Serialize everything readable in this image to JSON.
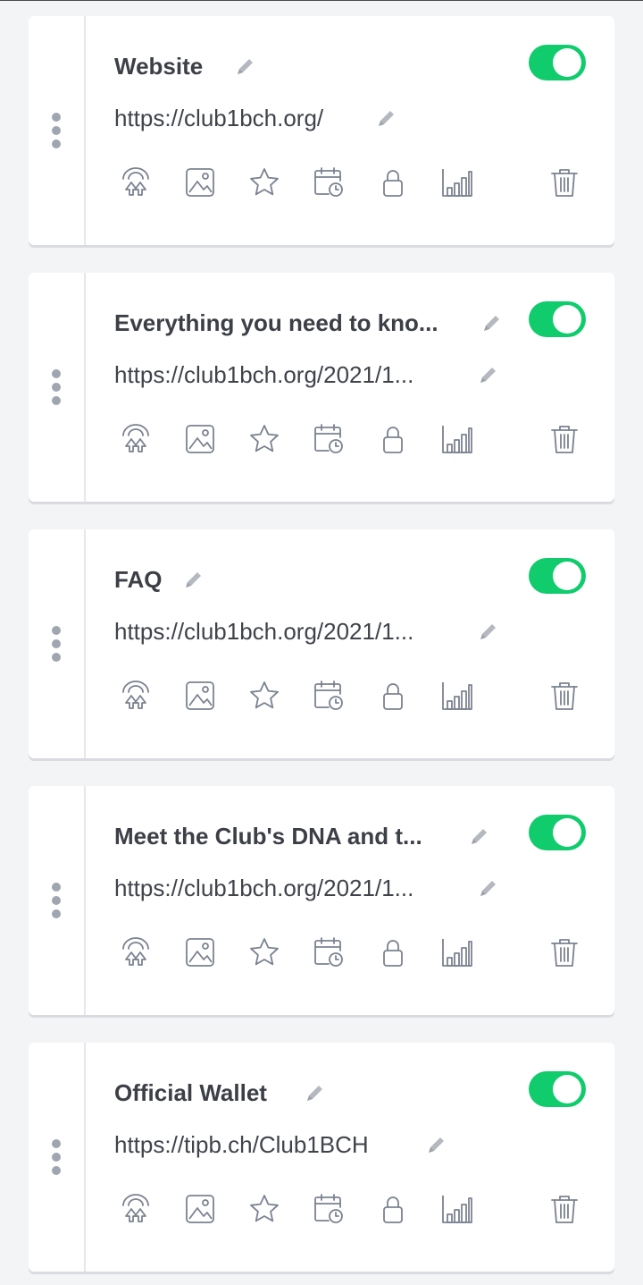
{
  "links": [
    {
      "title": "Website",
      "url": "https://club1bch.org/",
      "enabled": true
    },
    {
      "title": "Everything you need to kno...",
      "url": "https://club1bch.org/2021/1...",
      "enabled": true
    },
    {
      "title": "FAQ",
      "url": "https://club1bch.org/2021/1...",
      "enabled": true
    },
    {
      "title": "Meet the Club's DNA and t...",
      "url": "https://club1bch.org/2021/1...",
      "enabled": true
    },
    {
      "title": "Official Wallet",
      "url": "https://tipb.ch/Club1BCH",
      "enabled": true
    }
  ],
  "actions": [
    "redirect-icon",
    "thumbnail-icon",
    "star-icon",
    "schedule-icon",
    "lock-icon",
    "analytics-icon",
    "trash-icon"
  ],
  "colors": {
    "toggle_on": "#10cc6c",
    "icon": "#7b8290",
    "pencil": "#b5b9bf",
    "background": "#f3f4f6"
  }
}
